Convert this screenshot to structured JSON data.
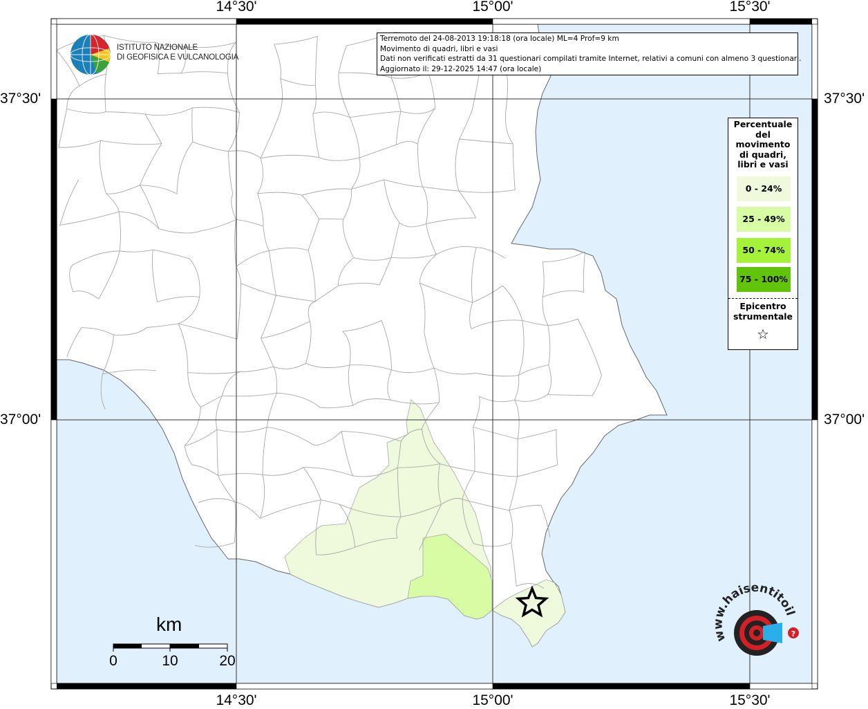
{
  "map": {
    "info": {
      "line1": "Terremoto del 24-08-2013 19:18:18 (ora locale) ML=4 Prof=9 km",
      "line2": "Movimento di quadri, libri e vasi",
      "line3": "Dati non verificati estratti da 31 questionari compilati tramite Internet, relativi a comuni con almeno 3 questionari.",
      "line4": "Aggiornato il: 29-12-2025 14:47 (ora locale)"
    },
    "longitude_ticks": [
      "14°30'",
      "15°00'",
      "15°30'"
    ],
    "latitude_ticks": [
      "37°30'",
      "37°00'"
    ],
    "legend": {
      "title": "Percentuale del movimento di quadri, libri e vasi",
      "title_lines": [
        "Percentuale",
        "del",
        "movimento",
        "di quadri,",
        "libri e vasi"
      ],
      "classes": [
        {
          "label": "0 - 24%",
          "color": "#eefadb"
        },
        {
          "label": "25 - 49%",
          "color": "#d8fca3"
        },
        {
          "label": "50 - 74%",
          "color": "#a4f23a"
        },
        {
          "label": "75 - 100%",
          "color": "#62c40a"
        }
      ],
      "epicenter_lines": [
        "Epicentro",
        "strumentale"
      ],
      "epicenter_symbol": "star-icon"
    },
    "logo": {
      "lines": [
        "ISTITUTO NAZIONALE",
        "DI GEOFISICA E VULCANOLOGIA"
      ]
    },
    "scalebar": {
      "unit": "km",
      "labels": [
        "0",
        "10",
        "20"
      ]
    },
    "watermark_text": "www.haisentitoilterremoto.it",
    "colors": {
      "sea": "#e0f0fc",
      "land": "#ffffff",
      "boundary": "#a8a8a8",
      "grid": "#333333",
      "class_0_24": "#eefadb",
      "class_25_49": "#d8fca3"
    }
  }
}
